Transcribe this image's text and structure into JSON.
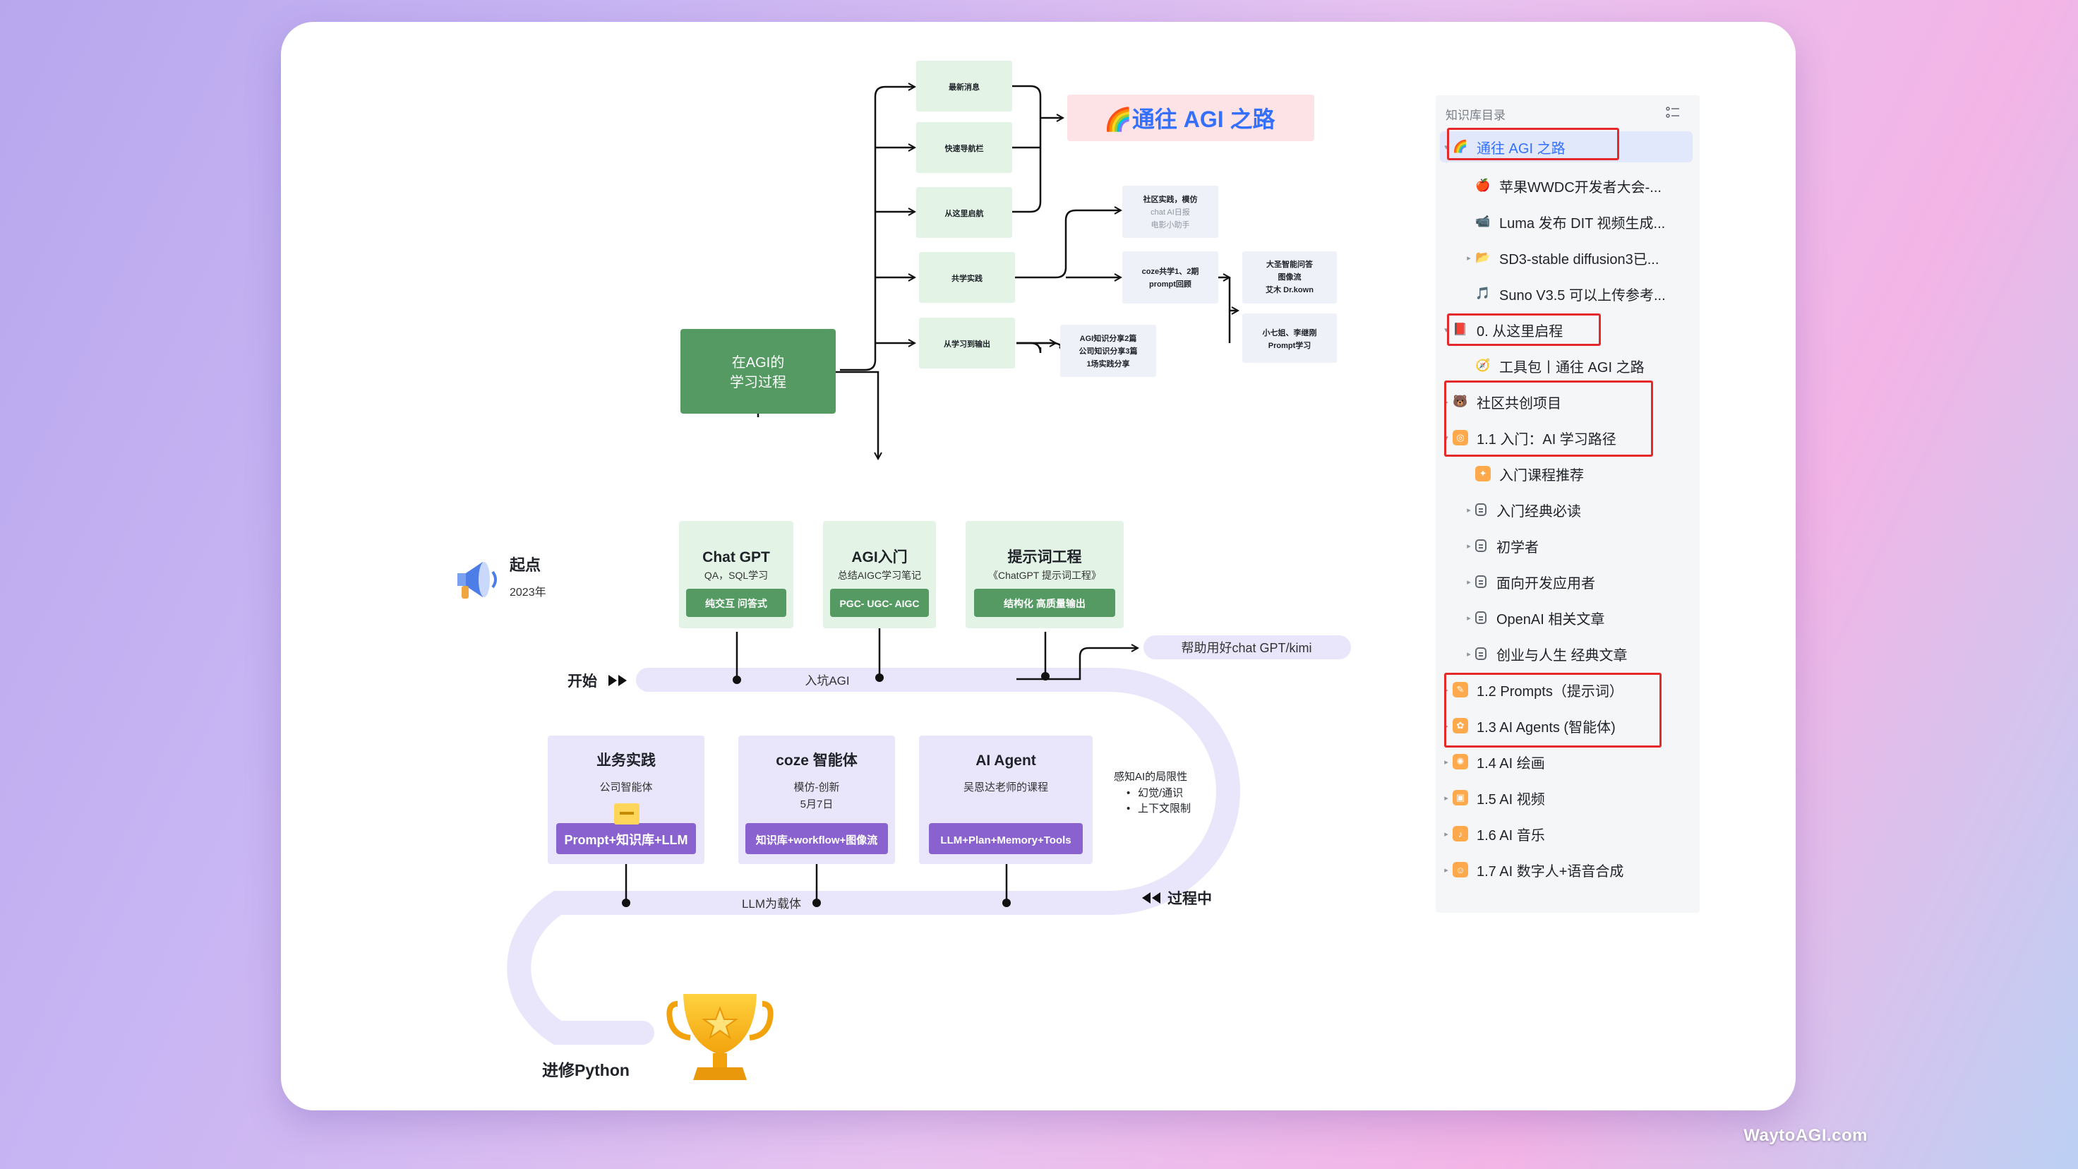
{
  "watermark": "WaytoAGI.com",
  "diagram": {
    "title_banner": "🌈通往 AGI 之路",
    "center_box": [
      "在AGI的",
      "学习过程"
    ],
    "nav_items": [
      "最新消息",
      "快速导航栏",
      "从这里启航",
      "共学实践",
      "从学习到输出"
    ],
    "practice_box": [
      "社区实践，模仿",
      "chat AI日报",
      "电影小助手"
    ],
    "coze_box": [
      "coze共学1、2期",
      "prompt回顾"
    ],
    "right_box1": [
      "大圣智能问答",
      "图像流",
      "艾木 Dr.kown"
    ],
    "right_box2": [
      "小七姐、李继刚",
      "Prompt学习"
    ],
    "output_box": [
      "AGI知识分享2篇",
      "公司知识分享3篇",
      "1场实践分享"
    ],
    "start": {
      "title": "起点",
      "year": "2023年"
    },
    "begin_label": "开始",
    "road1_label": "入坑AGI",
    "road2_label": "LLM为载体",
    "in_progress": "过程中",
    "python": "进修Python",
    "help_pill": "帮助用好chat GPT/kimi",
    "cards_top": [
      {
        "title": "Chat GPT",
        "sub": "QA，SQL学习",
        "tag": "纯交互 问答式"
      },
      {
        "title": "AGI入门",
        "sub": "总结AIGC学习笔记",
        "tag": "PGC- UGC- AIGC"
      },
      {
        "title": "提示词工程",
        "sub": "《ChatGPT 提示词工程》",
        "tag": "结构化 高质量输出"
      }
    ],
    "cards_bottom": [
      {
        "title": "业务实践",
        "sub1": "公司智能体",
        "sub2": "",
        "tag": "Prompt+知识库+LLM"
      },
      {
        "title": "coze 智能体",
        "sub1": "模仿-创新",
        "sub2": "5月7日",
        "tag": "知识库+workflow+图像流"
      },
      {
        "title": "AI Agent",
        "sub1": "吴恩达老师的课程",
        "sub2": "",
        "tag": "LLM+Plan+Memory+Tools"
      }
    ],
    "limits": {
      "title": "感知AI的局限性",
      "items": [
        "幻觉/通识",
        "上下文限制"
      ]
    }
  },
  "sidebar": {
    "header": "知识库目录",
    "items": [
      {
        "label": "通往 AGI 之路",
        "icon": "🌈",
        "arrow": "▾",
        "active": true
      },
      {
        "label": "苹果WWDC开发者大会-...",
        "icon": "🍎",
        "arrow": ""
      },
      {
        "label": "Luma 发布 DIT 视频生成...",
        "icon": "📹",
        "arrow": ""
      },
      {
        "label": "SD3-stable diffusion3已...",
        "icon": "📂",
        "arrow": "▸"
      },
      {
        "label": "Suno V3.5 可以上传参考...",
        "icon": "🎵",
        "arrow": ""
      },
      {
        "label": "0. 从这里启程",
        "icon": "📕",
        "arrow": "▾"
      },
      {
        "label": "工具包丨通往 AGI 之路",
        "icon": "🧭",
        "arrow": ""
      },
      {
        "label": "社区共创项目",
        "icon": "🐻",
        "arrow": "▸"
      },
      {
        "label": "1.1 入门：AI 学习路径",
        "icon": "🟠",
        "arrow": "▾"
      },
      {
        "label": "入门课程推荐",
        "icon": "🟧",
        "arrow": ""
      },
      {
        "label": "入门经典必读",
        "icon": "doc",
        "arrow": "▸"
      },
      {
        "label": "初学者",
        "icon": "doc",
        "arrow": "▸"
      },
      {
        "label": "面向开发应用者",
        "icon": "doc",
        "arrow": "▸"
      },
      {
        "label": "OpenAI 相关文章",
        "icon": "doc",
        "arrow": "▸"
      },
      {
        "label": "创业与人生 经典文章",
        "icon": "doc",
        "arrow": "▸"
      },
      {
        "label": "1.2 Prompts（提示词）",
        "icon": "🟠",
        "arrow": "▸"
      },
      {
        "label": "1.3 AI Agents (智能体)",
        "icon": "🟠",
        "arrow": "▸"
      },
      {
        "label": "1.4 AI 绘画",
        "icon": "🟠",
        "arrow": "▸"
      },
      {
        "label": "1.5 AI 视频",
        "icon": "🟠",
        "arrow": "▸"
      },
      {
        "label": "1.6 AI 音乐",
        "icon": "🟠",
        "arrow": "▸"
      },
      {
        "label": "1.7 AI 数字人+语音合成",
        "icon": "🟠",
        "arrow": "▸"
      }
    ]
  },
  "colors": {
    "green_dark": "#559a63",
    "green_light": "#e3f4e6",
    "lavender": "#e7e3fb",
    "purple": "#8a62cf",
    "banner_bg": "#fde3e5",
    "highlight_red": "#e5282a",
    "link_blue": "#3370ff"
  }
}
